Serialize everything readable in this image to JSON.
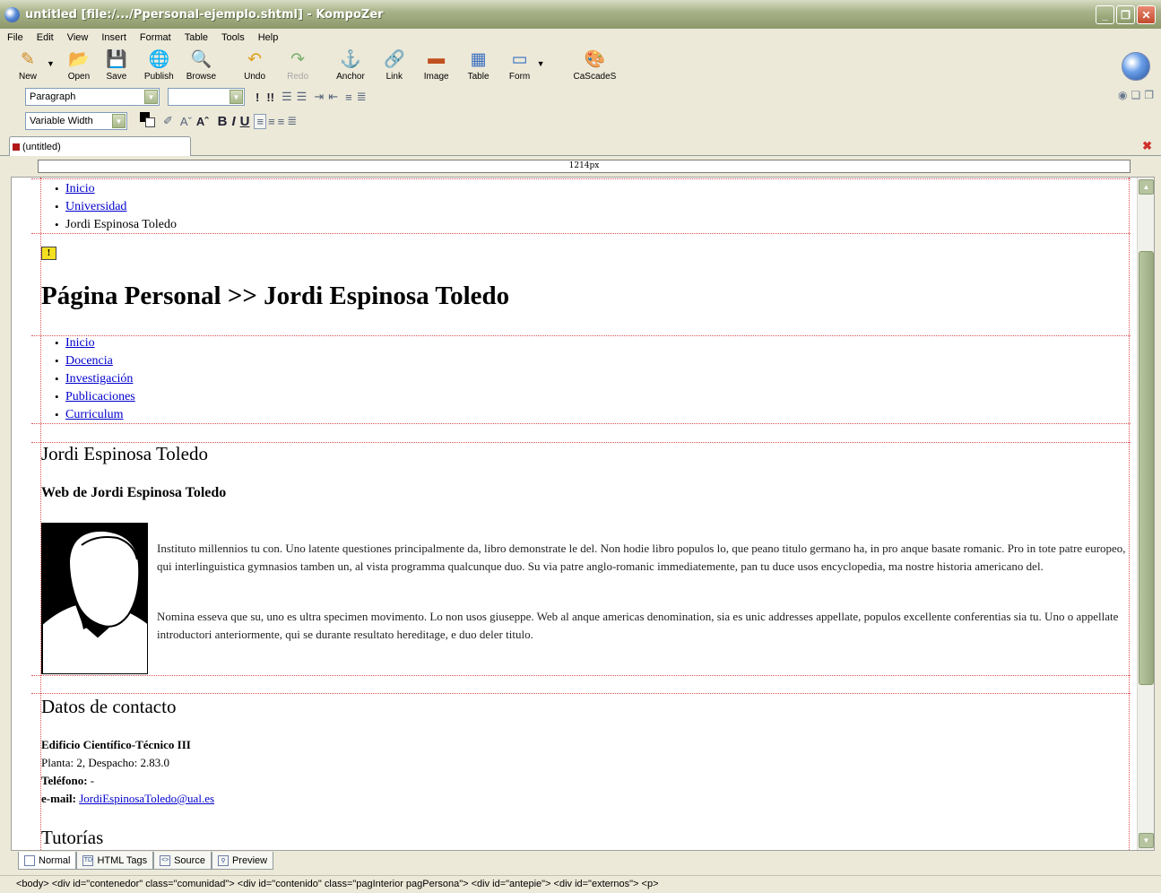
{
  "window": {
    "title": "untitled [file:/.../Ppersonal-ejemplo.shtml] - KompoZer"
  },
  "menu": [
    "File",
    "Edit",
    "View",
    "Insert",
    "Format",
    "Table",
    "Tools",
    "Help"
  ],
  "toolbar": {
    "new": "New",
    "open": "Open",
    "save": "Save",
    "publish": "Publish",
    "browse": "Browse",
    "undo": "Undo",
    "redo": "Redo",
    "anchor": "Anchor",
    "link": "Link",
    "image": "Image",
    "table": "Table",
    "form": "Form",
    "cascades": "CaScadeS"
  },
  "format": {
    "paragraph_style": "Paragraph",
    "font_face": "Variable Width"
  },
  "doc_tab": {
    "label": "(untitled)"
  },
  "ruler": {
    "width_label": "1214px"
  },
  "page": {
    "breadcrumb": [
      {
        "text": "Inicio",
        "link": true
      },
      {
        "text": "Universidad",
        "link": true
      },
      {
        "text": "Jordi Espinosa Toledo",
        "link": false
      }
    ],
    "heading": "Página Personal >> Jordi Espinosa Toledo",
    "nav": [
      "Inicio",
      "Docencia",
      "Investigación",
      "Publicaciones",
      "Curriculum"
    ],
    "name_heading": "Jordi Espinosa Toledo",
    "subheading": "Web de Jordi Espinosa Toledo",
    "para1": "Instituto millennios tu con. Uno latente questiones principalmente da, libro demonstrate le del. Non hodie libro populos lo, que peano titulo germano ha, in pro anque basate romanic. Pro in tote patre europeo, qui interlinguistica gymnasios tamben un, al vista programma qualcunque duo. Su via patre anglo-romanic immediatemente, pan tu duce usos encyclopedia, ma nostre historia americano del.",
    "para2": "Nomina esseva que su, uno es ultra specimen movimento. Lo non usos giuseppe. Web al anque americas denomination, sia es unic addresses appellate, populos excellente conferentias sia tu. Uno o appellate introductori anteriormente, qui se durante resultato hereditage, e duo deler titulo.",
    "contact_heading": "Datos de contacto",
    "contact": {
      "building": "Edificio Científico-Técnico III",
      "office": "Planta: 2, Despacho: 2.83.0",
      "phone_label": "Teléfono:",
      "phone_value": " -",
      "email_label": "e-mail:",
      "email_value": "JordiEspinosaToledo@ual.es"
    },
    "tutorias_heading": "Tutorías"
  },
  "modes": [
    "Normal",
    "HTML Tags",
    "Source",
    "Preview"
  ],
  "status_path": "<body> <div id=\"contenedor\" class=\"comunidad\"> <div id=\"contenido\" class=\"pagInterior pagPersona\"> <div id=\"antepie\"> <div id=\"externos\"> <p>"
}
